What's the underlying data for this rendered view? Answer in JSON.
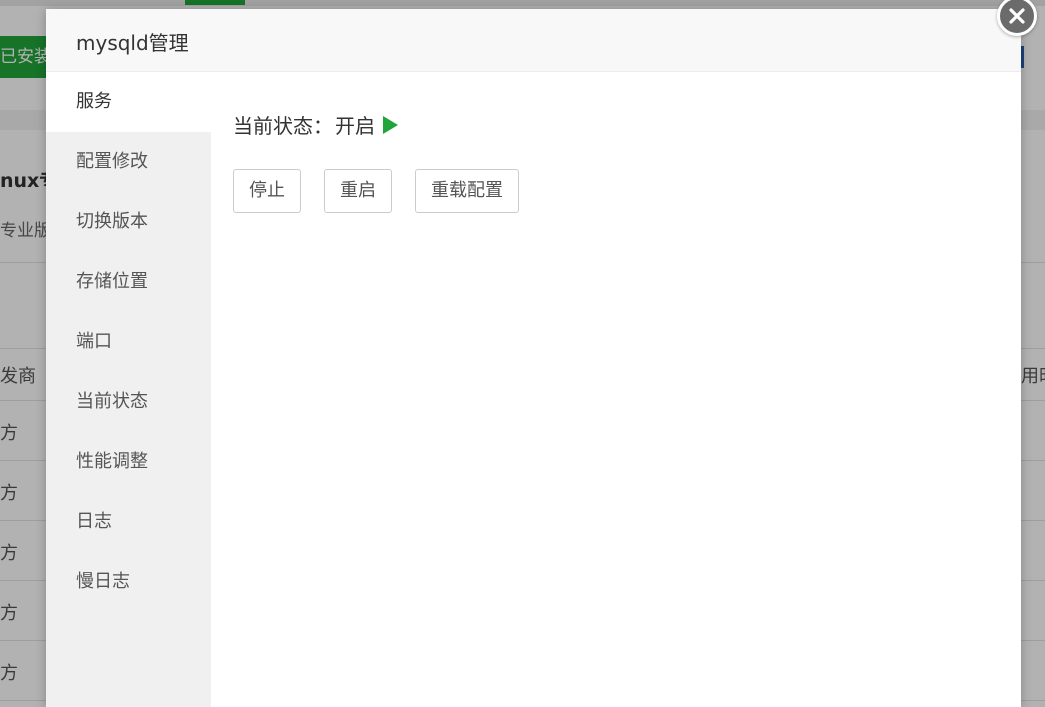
{
  "background": {
    "install_button": "已安装",
    "title_fragment": "nux专",
    "subtitle_fragment": "专业版",
    "table_header_left": "发商",
    "table_header_right": "用时",
    "row_cells": [
      "方",
      "方",
      "方",
      "方",
      "方"
    ]
  },
  "modal": {
    "title": "mysqld管理",
    "close_icon": "close-icon",
    "sidebar": {
      "items": [
        {
          "label": "服务",
          "active": true
        },
        {
          "label": "配置修改"
        },
        {
          "label": "切换版本"
        },
        {
          "label": "存储位置"
        },
        {
          "label": "端口"
        },
        {
          "label": "当前状态"
        },
        {
          "label": "性能调整"
        },
        {
          "label": "日志"
        },
        {
          "label": "慢日志"
        }
      ]
    },
    "service": {
      "status_label": "当前状态：",
      "status_value": "开启",
      "status_icon": "play-icon",
      "status_color": "#20a53a",
      "buttons": {
        "stop": "停止",
        "restart": "重启",
        "reload": "重载配置"
      }
    }
  },
  "colors": {
    "accent_green": "#20a53a",
    "sidebar_bg": "#f0f0f0",
    "header_bg": "#f8f8f8"
  }
}
